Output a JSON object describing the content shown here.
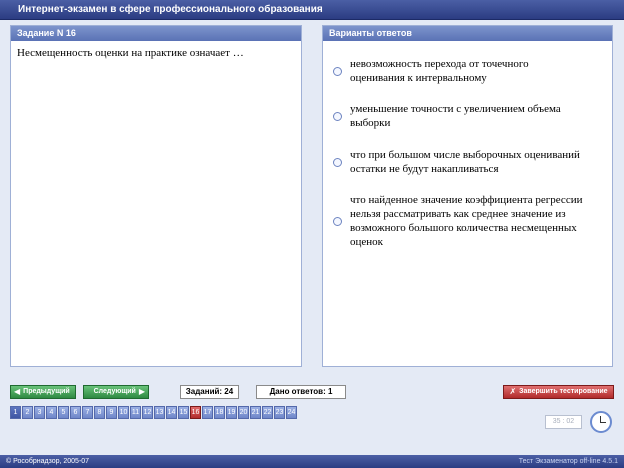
{
  "header": {
    "title": "Интернет-экзамен в сфере профессионального образования"
  },
  "question": {
    "heading": "Задание N 16",
    "text": "Несмещенность оценки на практике означает …"
  },
  "answers": {
    "heading": "Варианты ответов",
    "options": [
      {
        "line1": "невозможность перехода от точечного",
        "line2": "оценивания к интервальному"
      },
      {
        "line1": "уменьшение точности с увеличением объема",
        "line2": "выборки"
      },
      {
        "line1": "что при большом числе выборочных оцениваний",
        "line2": "остатки не будут накапливаться"
      },
      {
        "line1": "что найденное значение коэффициента регрессии",
        "line2": "нельзя рассматривать как среднее значение из",
        "line3": "возможного большого количества несмещенных",
        "line4": "оценок"
      }
    ]
  },
  "navigation": {
    "prev_label": "Предыдущий",
    "next_label": "Следующий",
    "tasks_count": "Заданий: 24",
    "answers_given": "Дано ответов: 1",
    "finish_label": "Завершить тестирование",
    "current_page": 16,
    "pages": [
      "1",
      "2",
      "3",
      "4",
      "5",
      "6",
      "7",
      "8",
      "9",
      "10",
      "11",
      "12",
      "13",
      "14",
      "15",
      "16",
      "17",
      "18",
      "19",
      "20",
      "21",
      "22",
      "23",
      "24"
    ]
  },
  "timer": {
    "value": "35 : 02"
  },
  "footer": {
    "copyright": "© Рособрнадзор, 2005-07",
    "version": "Тест Экзаменатор off-line 4.5.1"
  },
  "colors": {
    "accent": "#2b3c82",
    "current_page": "#b32d2d",
    "green_button": "#2f8a43"
  }
}
